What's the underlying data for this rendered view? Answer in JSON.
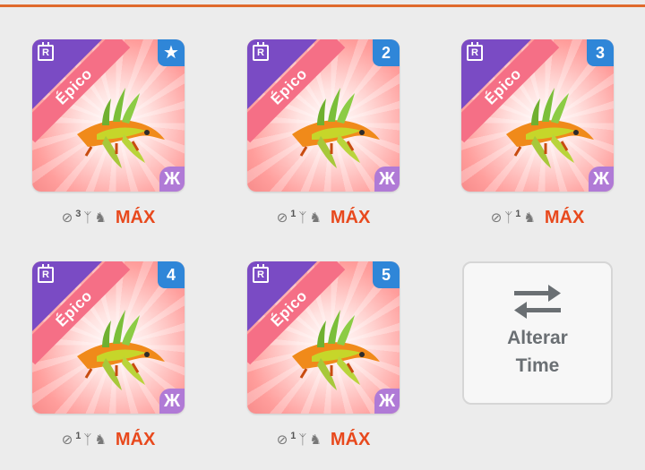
{
  "team": [
    {
      "rarity": "Épico",
      "rarity_icon": "R",
      "badge": "★",
      "badge_type": "star",
      "element_icon": "Ж",
      "stat_count": "3",
      "pos": "mid",
      "max_label": "MÁX"
    },
    {
      "rarity": "Épico",
      "rarity_icon": "R",
      "badge": "2",
      "badge_type": "number",
      "element_icon": "Ж",
      "stat_count": "1",
      "pos": "mid",
      "max_label": "MÁX"
    },
    {
      "rarity": "Épico",
      "rarity_icon": "R",
      "badge": "3",
      "badge_type": "number",
      "element_icon": "Ж",
      "stat_count": "1",
      "pos": "after",
      "max_label": "MÁX"
    },
    {
      "rarity": "Épico",
      "rarity_icon": "R",
      "badge": "4",
      "badge_type": "number",
      "element_icon": "Ж",
      "stat_count": "1",
      "pos": "mid",
      "max_label": "MÁX"
    },
    {
      "rarity": "Épico",
      "rarity_icon": "R",
      "badge": "5",
      "badge_type": "number",
      "element_icon": "Ж",
      "stat_count": "1",
      "pos": "mid",
      "max_label": "MÁX"
    }
  ],
  "swap_button": {
    "line1": "Alterar",
    "line2": "Time"
  },
  "colors": {
    "accent": "#e06a2c",
    "max": "#e8491d",
    "badge": "#2f86d8",
    "element": "#b07ad6"
  }
}
